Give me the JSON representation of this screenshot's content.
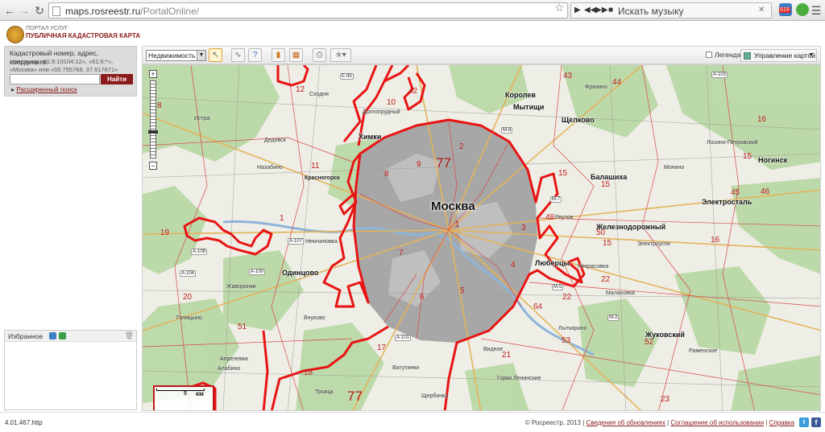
{
  "browser": {
    "url_domain": "maps.rosreestr.ru",
    "url_path": "/PortalOnline/",
    "music_search": "Искать музыку",
    "ext_badge": "519"
  },
  "header": {
    "portal_label": "ПОРТАЛ УСЛУГ",
    "title": "ПУБЛИЧНАЯ КАДАСТРОВАЯ КАРТА"
  },
  "search": {
    "hint": "Кадастровый номер, адрес, координата:",
    "example": "Например «61:6:10104:12», «61:6:*», «Москва» или «55.755768, 37.617671»",
    "input_value": "",
    "button_label": "Найти",
    "advanced_label": "Расширенный поиск"
  },
  "favorites": {
    "label": "Избранное"
  },
  "toolbar": {
    "layer_select": "Недвижимость",
    "legend_label": "Легенда",
    "map_control_label": "Управление картой"
  },
  "map": {
    "center_label": "Москва",
    "big_label": "77",
    "bottom_label": "77",
    "scale_value": "5",
    "scale_unit": "км",
    "cities": [
      {
        "name": "Химки"
      },
      {
        "name": "Королев"
      },
      {
        "name": "Мытищи"
      },
      {
        "name": "Щелково"
      },
      {
        "name": "Балашиха"
      },
      {
        "name": "Ногинск"
      },
      {
        "name": "Электросталь"
      },
      {
        "name": "Железнодорожный"
      },
      {
        "name": "Люберцы"
      },
      {
        "name": "Одинцово"
      },
      {
        "name": "Жуковский"
      },
      {
        "name": "Красногорск"
      }
    ],
    "towns": [
      {
        "name": "Долгопрудный"
      },
      {
        "name": "Нахабино"
      },
      {
        "name": "Истра"
      },
      {
        "name": "Дедовск"
      },
      {
        "name": "Сходня"
      },
      {
        "name": "Фрязино"
      },
      {
        "name": "Монино"
      },
      {
        "name": "Лосино-Петровский"
      },
      {
        "name": "Реутов"
      },
      {
        "name": "Электроугли"
      },
      {
        "name": "Некрасовка"
      },
      {
        "name": "Малаховка"
      },
      {
        "name": "Лыткарино"
      },
      {
        "name": "Видное"
      },
      {
        "name": "Внуково"
      },
      {
        "name": "Апрелевка"
      },
      {
        "name": "Алабино"
      },
      {
        "name": "Голицыно"
      },
      {
        "name": "Троицк"
      },
      {
        "name": "Щербинка"
      },
      {
        "name": "Раменское"
      },
      {
        "name": "Немчиновка"
      },
      {
        "name": "Горки Ленинские"
      },
      {
        "name": "Жаворонки"
      },
      {
        "name": "Ватутинки"
      }
    ],
    "regions": [
      "8",
      "10",
      "42",
      "43",
      "44",
      "15",
      "16",
      "46",
      "45",
      "15",
      "15",
      "48",
      "50",
      "22",
      "22",
      "53",
      "52",
      "23",
      "21",
      "64",
      "4",
      "3",
      "2",
      "9",
      "8",
      "1",
      "7",
      "6",
      "5",
      "1",
      "11",
      "19",
      "20",
      "51",
      "17",
      "18",
      "12",
      "16",
      "15"
    ],
    "highways": [
      "E-95",
      "A-101",
      "M-8",
      "M-7",
      "M-5",
      "A-103",
      "A-107",
      "A-108",
      "A-100",
      "A-104",
      "M-2"
    ]
  },
  "footer": {
    "version": "4.01.467.http",
    "copyright": "© Росреестр, 2013",
    "updates": "Сведения об обновлениях",
    "agreement": "Соглашение об использовании",
    "help": "Справка"
  }
}
